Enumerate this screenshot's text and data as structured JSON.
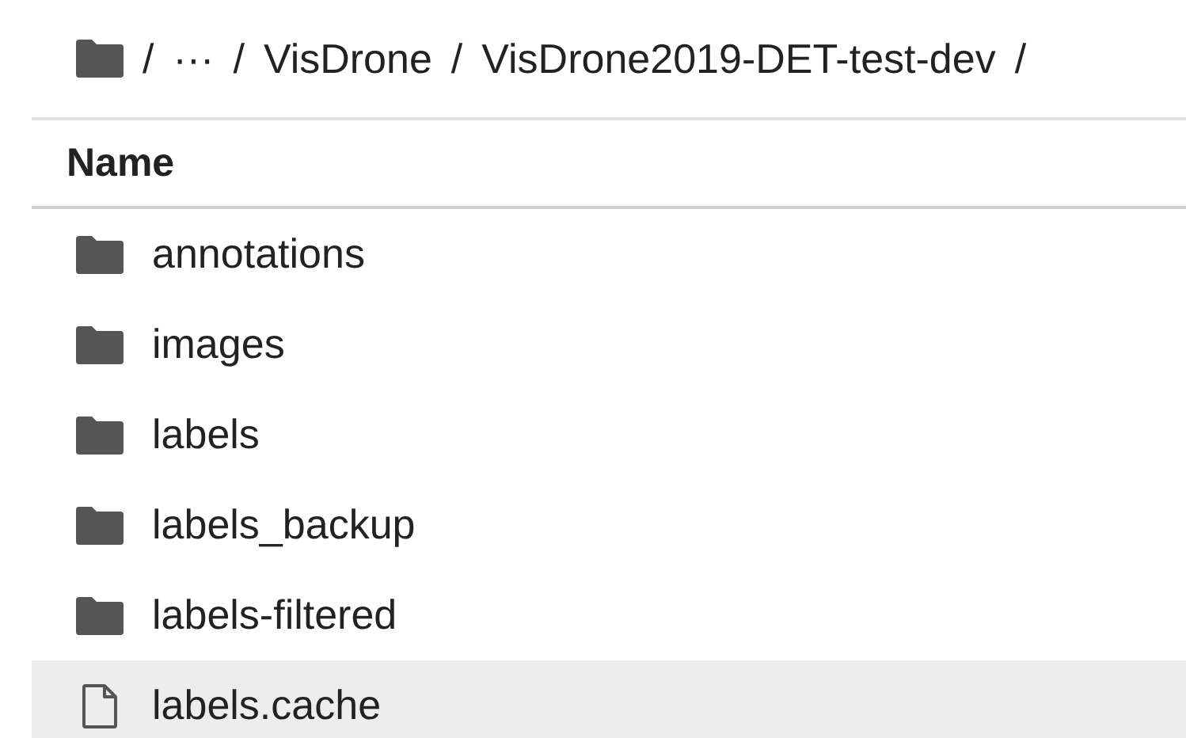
{
  "breadcrumb": {
    "separator": "/",
    "items": [
      "···",
      "VisDrone",
      "VisDrone2019-DET-test-dev"
    ]
  },
  "table": {
    "columns": [
      "Name"
    ],
    "rows": [
      {
        "kind": "folder",
        "name": "annotations",
        "highlighted": false
      },
      {
        "kind": "folder",
        "name": "images",
        "highlighted": false
      },
      {
        "kind": "folder",
        "name": "labels",
        "highlighted": false
      },
      {
        "kind": "folder",
        "name": "labels_backup",
        "highlighted": false
      },
      {
        "kind": "folder",
        "name": "labels-filtered",
        "highlighted": false
      },
      {
        "kind": "file",
        "name": "labels.cache",
        "highlighted": true
      }
    ]
  }
}
